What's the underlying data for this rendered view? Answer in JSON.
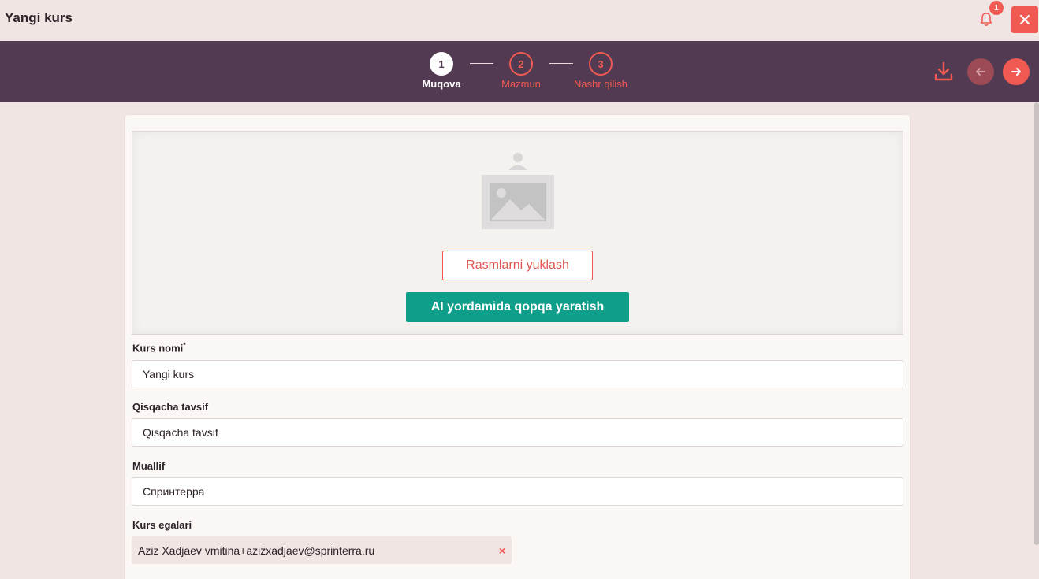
{
  "header": {
    "title": "Yangi kurs",
    "notification_count": "1"
  },
  "stepper": {
    "steps": [
      {
        "number": "1",
        "label": "Muqova",
        "state": "active"
      },
      {
        "number": "2",
        "label": "Mazmun",
        "state": "inactive"
      },
      {
        "number": "3",
        "label": "Nashr qilish",
        "state": "inactive"
      }
    ]
  },
  "cover": {
    "upload_label": "Rasmlarni yuklash",
    "ai_label": "AI yordamida qopqa yaratish"
  },
  "form": {
    "course_name": {
      "label": "Kurs nomi",
      "required_mark": "*",
      "value": "Yangi kurs"
    },
    "short_description": {
      "label": "Qisqacha tavsif",
      "value": "Qisqacha tavsif"
    },
    "author": {
      "label": "Muallif",
      "value": "Спринтерра"
    },
    "owners": {
      "label": "Kurs egalari",
      "items": [
        {
          "text": "Aziz Xadjaev vmitina+azizxadjaev@sprinterra.ru",
          "remove": "×"
        }
      ]
    }
  },
  "colors": {
    "accent": "#f05a52",
    "stepbar_bg": "#523a52",
    "ai_button": "#0e9e8a",
    "page_bg": "#f1e5e3"
  },
  "icons": [
    "bell-icon",
    "close-icon",
    "download-icon",
    "arrow-left-icon",
    "arrow-right-icon",
    "image-placeholder-icon"
  ]
}
